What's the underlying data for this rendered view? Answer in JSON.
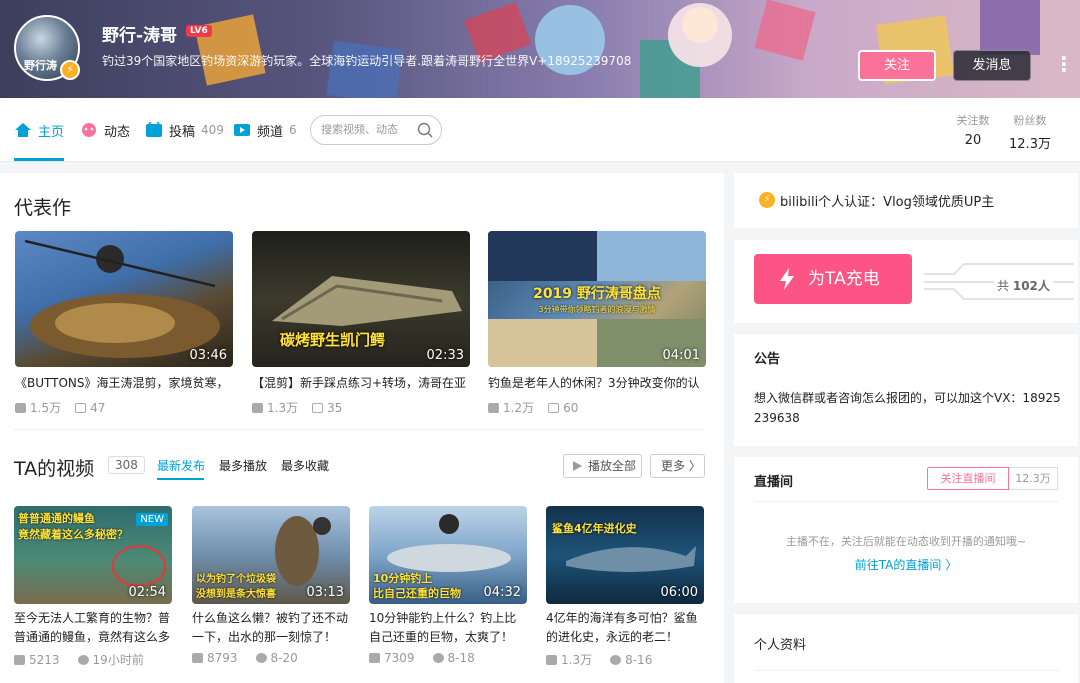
{
  "header": {
    "username": "野行-涛哥",
    "level": "LV6",
    "avatar_text": "野行涛",
    "signature": "钓过39个国家地区钓场资深游钓玩家。全球海钓运动引导者.跟着涛哥野行全世界V+18925239708",
    "follow_label": "关注",
    "message_label": "发消息",
    "more_label": "⋮"
  },
  "nav": {
    "home": "主页",
    "dynamic": "动态",
    "posts": "投稿",
    "posts_count": "409",
    "channels": "频道",
    "channels_count": "6",
    "search_placeholder": "搜索视频、动态",
    "following_label": "关注数",
    "following_value": "20",
    "fans_label": "粉丝数",
    "fans_value": "12.3万"
  },
  "masterpieces": {
    "title": "代表作",
    "items": [
      {
        "title": "《BUTTONS》海王涛混剪，家境贫寒，",
        "duration": "03:46",
        "plays": "1.5万",
        "danmaku": "47"
      },
      {
        "title": "【混剪】新手踩点练习+转场，涛哥在亚",
        "duration": "02:33",
        "plays": "1.3万",
        "danmaku": "35",
        "overlay": "碳烤野生凯门鳄"
      },
      {
        "title": "钓鱼是老年人的休闲？3分钟改变你的认",
        "duration": "04:01",
        "plays": "1.2万",
        "danmaku": "60",
        "overlay": "2019 野行涛哥盘点",
        "overlay_sub": "3分钟带你领略钓者的浪漫与激情"
      }
    ]
  },
  "videos": {
    "title": "TA的视频",
    "count": "308",
    "tab_latest": "最新发布",
    "tab_most_played": "最多播放",
    "tab_most_fav": "最多收藏",
    "play_all": "播放全部",
    "more": "更多 〉",
    "items": [
      {
        "title": "至今无法人工繁育的生物？普普通通的鳗鱼，竟然有这么多",
        "duration": "02:54",
        "plays": "5213",
        "date": "19小时前",
        "badge": "NEW",
        "overlay1": "普普通通的鳗鱼",
        "overlay2": "竟然藏着这么多秘密？"
      },
      {
        "title": "什么鱼这么懒？被钓了还不动一下，出水的那一刻惊了！",
        "duration": "03:13",
        "plays": "8793",
        "date": "8-20",
        "overlay1": "以为钓了个垃圾袋",
        "overlay2": "没想到是条大惊喜"
      },
      {
        "title": "10分钟能钓上什么？钓上比自己还重的巨物，太爽了！",
        "duration": "04:32",
        "plays": "7309",
        "date": "8-18",
        "overlay1": "10分钟钓上",
        "overlay2": "比自己还重的巨物"
      },
      {
        "title": "4亿年的海洋有多可怕？鲨鱼的进化史，永远的老二！",
        "duration": "06:00",
        "plays": "1.3万",
        "date": "8-16",
        "overlay1": "鲨鱼4亿年进化史"
      }
    ]
  },
  "sidebar": {
    "verify_text": "bilibili个人认证：Vlog领域优质UP主",
    "charge_label": "为TA充电",
    "charge_count_prefix": "共",
    "charge_count": "102人",
    "notice_title": "公告",
    "notice_body": "想入微信群或者咨询怎么报团的，可以加这个VX：18925239638",
    "live_title": "直播间",
    "live_follow": "关注直播间",
    "live_count": "12.3万",
    "live_tip": "主播不在，关注后就能在动态收到开播的通知哦~",
    "live_link": "前往TA的直播间 〉",
    "profile_title": "个人资料"
  },
  "colors": {
    "accent": "#00a1d6",
    "pink": "#fb7299",
    "charge": "#fb5485"
  }
}
